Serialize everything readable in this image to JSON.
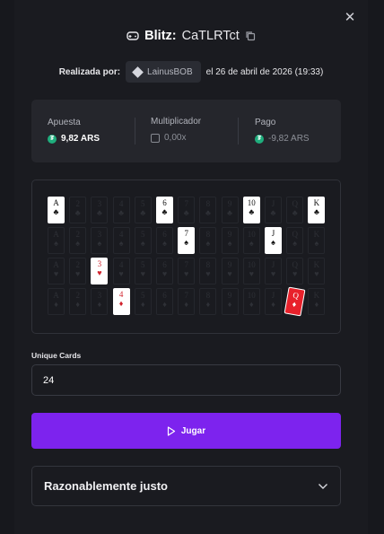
{
  "modal": {
    "close_icon": "close-icon",
    "game": "Blitz:",
    "code": "CaTLRTct",
    "meta": {
      "played_by_label": "Realizada por:",
      "user": "LainusBOB",
      "date": "el 26 de abril de 2026 (19:33)"
    },
    "stats": {
      "bet": {
        "label": "Apuesta",
        "value": "9,82 ARS"
      },
      "multiplier": {
        "label": "Multiplicador",
        "value": "0,00x"
      },
      "payout": {
        "label": "Pago",
        "value": "-9,82 ARS"
      }
    },
    "board": {
      "rows": [
        {
          "suit": "♣",
          "ranks": [
            "A",
            "2",
            "3",
            "4",
            "5",
            "6",
            "7",
            "8",
            "9",
            "10",
            "J",
            "Q",
            "K"
          ],
          "revealed": [
            0,
            5,
            9,
            12
          ],
          "red": false
        },
        {
          "suit": "♠",
          "ranks": [
            "A",
            "2",
            "3",
            "4",
            "5",
            "6",
            "7",
            "8",
            "9",
            "10",
            "J",
            "Q",
            "K"
          ],
          "revealed": [
            6,
            10
          ],
          "red": false
        },
        {
          "suit": "♥",
          "ranks": [
            "A",
            "2",
            "3",
            "4",
            "5",
            "6",
            "7",
            "8",
            "9",
            "10",
            "J",
            "Q",
            "K"
          ],
          "revealed": [
            2
          ],
          "red": true
        },
        {
          "suit": "♦",
          "ranks": [
            "A",
            "2",
            "3",
            "4",
            "5",
            "6",
            "7",
            "8",
            "9",
            "10",
            "J",
            "Q",
            "K"
          ],
          "revealed": [
            3,
            11
          ],
          "red": true
        }
      ],
      "highlight": {
        "row": 3,
        "col": 11
      }
    },
    "unique_cards": {
      "label": "Unique Cards",
      "value": "24"
    },
    "play_label": "Jugar",
    "fairness": {
      "label": "Razonablemente justo"
    }
  },
  "colors": {
    "accent": "#7d23ee",
    "coin": "#1fae7d",
    "highlight_card": "#e8212b"
  }
}
